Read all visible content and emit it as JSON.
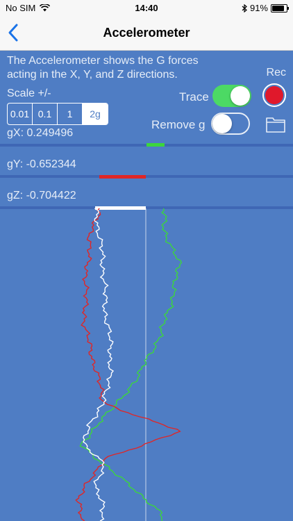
{
  "status": {
    "carrier": "No SIM",
    "time": "14:40",
    "battery_percent": "91%",
    "battery_level": 0.91
  },
  "nav": {
    "title": "Accelerometer"
  },
  "description": "The Accelerometer shows the G forces acting in the X, Y, and Z directions.",
  "record": {
    "label": "Rec"
  },
  "scale": {
    "label": "Scale +/-",
    "options": [
      "0.01",
      "0.1",
      "1",
      "2g"
    ],
    "selected": "2g"
  },
  "trace": {
    "label": "Trace",
    "on": true
  },
  "remove_gravity": {
    "label": "Remove g",
    "on": false
  },
  "readings": {
    "gx": "gX:  0.249496",
    "gy": "gY:  -0.652344",
    "gz": "gZ:  -0.704422"
  },
  "colors": {
    "background": "#4f7dc4",
    "x": "#3cd63c",
    "y": "#e02626",
    "z": "#ffffff",
    "accent": "#4cd964",
    "record": "#e0182b"
  }
}
